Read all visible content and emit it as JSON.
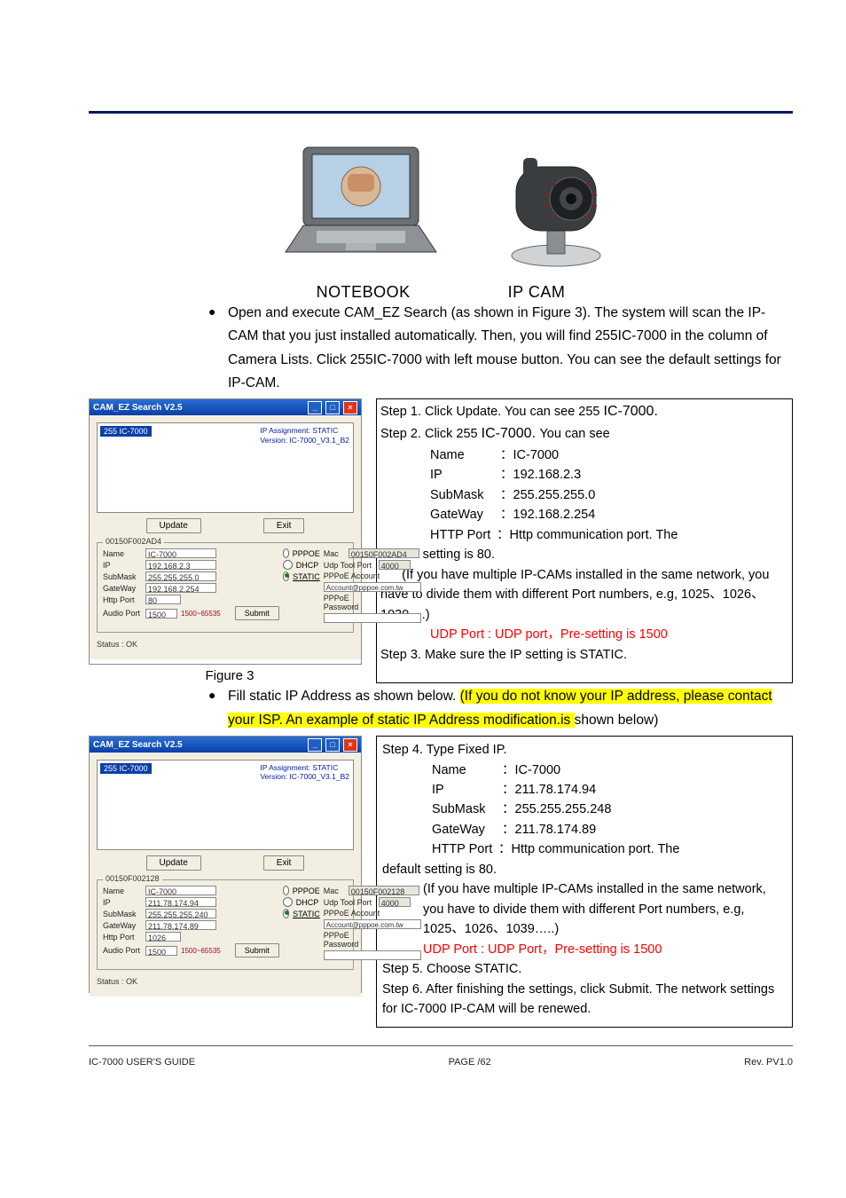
{
  "hardware": {
    "notebook": "NOTEBOOK",
    "ipcam": "IP CAM"
  },
  "para1": "Open and execute CAM_EZ Search (as shown in Figure 3). The system will scan the IP-CAM that you just installed automatically. Then, you will find 255IC-7000 in the column of Camera Lists. Click 255IC-7000 with left mouse button. You can see the default settings for IP-CAM.",
  "para2": "Fill static IP Address as shown below. (If you do not know your IP address, please contact your ISP. An example of static IP Address modification.is shown below)",
  "fig3_caption": "Figure 3",
  "box1": {
    "step1a": "Step 1. Click Update. You can see 255 ",
    "step1b": "IC-7000.",
    "step2a": "Step 2. Click 255 ",
    "step2b": "IC-7000. ",
    "step2c": "You can see",
    "name_l": "Name",
    "name_v": "：IC-7000",
    "ip_l": "IP",
    "ip_v": "：192.168.2.3",
    "sub_l": "SubMask",
    "sub_v": "：255.255.255.0",
    "gw_l": "GateWay",
    "gw_v": "：192.168.2.254",
    "http_l": "HTTP Port",
    "http_v": "：Http communication port. The",
    "http_def": "default setting is 80.",
    "multi": "      (If you have multiple IP-CAMs installed in the same network, you have to divide them with different Port numbers, e.g, 1025、1026、1039….)",
    "udp": "UDP Port : UDP port，Pre-setting is 1500",
    "step3": "Step 3. Make sure the IP setting is STATIC."
  },
  "box2": {
    "step4": "Step 4. Type Fixed IP.",
    "name_l": "Name",
    "name_v": "：IC-7000",
    "ip_l": "IP",
    "ip_v": "：211.78.174.94",
    "sub_l": "SubMask",
    "sub_v": "：255.255.255.248",
    "gw_l": "GateWay",
    "gw_v": "：211.78.174.89",
    "http_l": "HTTP Port",
    "http_v": "：Http communication port. The",
    "http_def": "default setting is 80.",
    "multi": "(If you have multiple IP-CAMs installed in the same network, you have to divide them with different Port numbers, e.g, 1025、1026、1039…..)",
    "udp": "UDP Port : UDP Port，Pre-setting is 1500",
    "step5": "Step 5. Choose STATIC.",
    "step6": "Step 6. After finishing the settings, click Submit. The network settings for IC-7000 IP-CAM will be renewed."
  },
  "shot1": {
    "title": "CAM_EZ Search V2.5",
    "listitem": "255 IC-7000",
    "assign1": "IP Assignment:  STATIC",
    "assign2": "Version: IC-7000_V3.1_B2",
    "update": "Update",
    "exit": "Exit",
    "submit": "Submit",
    "group": "00150F002AD4",
    "mac_l": "Mac",
    "mac_v": "00150F002AD4",
    "udptool_l": "Udp Tool Port",
    "udptool_v": "4000",
    "pppoe_acc_l": "PPPoE Account",
    "pppoe_acc_v": "Account@pppoe.com.tw",
    "pppoe_pwd_l": "PPPoE Password",
    "r_pppoe": "PPPOE",
    "r_dhcp": "DHCP",
    "r_static": "STATIC",
    "name_l": "Name",
    "name_v": "IC-7000",
    "ip_l": "IP",
    "ip_v": "192.168.2.3",
    "sub_l": "SubMask",
    "sub_v": "255.255.255.0",
    "gw_l": "GateWay",
    "gw_v": "192.168.2.254",
    "hp_l": "Http Port",
    "hp_v": "80",
    "ap_l": "Audio Port",
    "ap_v": "1500",
    "ap_hint": "1500~65535",
    "status": "Status :    OK"
  },
  "shot2": {
    "title": "CAM_EZ Search V2.5",
    "listitem": "255 IC-7000",
    "assign1": "IP Assignment:  STATIC",
    "assign2": "Version: IC-7000_V3.1_B2",
    "update": "Update",
    "exit": "Exit",
    "submit": "Submit",
    "group": "00150F002128",
    "mac_l": "Mac",
    "mac_v": "00150F002128",
    "udptool_l": "Udp Tool Port",
    "udptool_v": "4000",
    "pppoe_acc_l": "PPPoE Account",
    "pppoe_acc_v": "Account@pppoe.com.tw",
    "pppoe_pwd_l": "PPPoE Password",
    "r_pppoe": "PPPOE",
    "r_dhcp": "DHCP",
    "r_static": "STATIC",
    "name_l": "Name",
    "name_v": "IC-7000",
    "ip_l": "IP",
    "ip_v": "211.78.174.94",
    "sub_l": "SubMask",
    "sub_v": "255.255.255.240",
    "gw_l": "GateWay",
    "gw_v": "211.78.174.89",
    "hp_l": "Http Port",
    "hp_v": "1026",
    "ap_l": "Audio Port",
    "ap_v": "1500",
    "ap_hint": "1500~65535",
    "status": "Status :    OK"
  },
  "footer": {
    "left": "IC-7000 USER'S GUIDE",
    "mid": "PAGE   /62",
    "right": "Rev. PV1.0"
  }
}
